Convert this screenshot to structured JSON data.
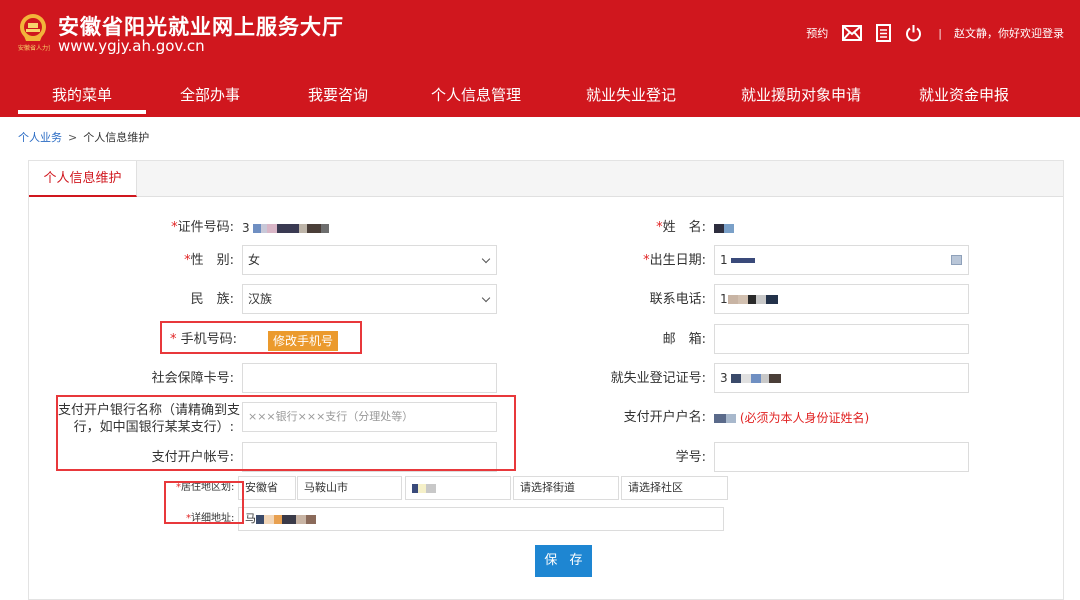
{
  "header": {
    "logo_small_text": "安徽省人力资源",
    "site_title": "安徽省阳光就业网上服务大厅",
    "site_url": "www.ygjy.ah.gov.cn",
    "appointment_label": "预约",
    "divider": "|",
    "welcome_text": "赵文静，你好欢迎登录",
    "icons": [
      "mail-icon",
      "document-icon",
      "power-icon"
    ]
  },
  "nav": {
    "items": [
      {
        "label": "我的菜单"
      },
      {
        "label": "全部办事"
      },
      {
        "label": "我要咨询"
      },
      {
        "label": "个人信息管理"
      },
      {
        "label": "就业失业登记"
      },
      {
        "label": "就业援助对象申请"
      },
      {
        "label": "就业资金申报"
      }
    ]
  },
  "breadcrumb": {
    "root": "个人业务",
    "separator": ">",
    "current": "个人信息维护"
  },
  "tab": {
    "label": "个人信息维护"
  },
  "form": {
    "required_mark": "*",
    "id_number": {
      "label": "证件号码:",
      "value": "3"
    },
    "name": {
      "label": "姓　名:"
    },
    "gender": {
      "label": "性　别:",
      "value": "女"
    },
    "birth_date": {
      "label": "出生日期:",
      "value": "1"
    },
    "ethnicity": {
      "label": "民　族:",
      "value": "汉族"
    },
    "phone": {
      "label": "联系电话:",
      "value": "1"
    },
    "mobile": {
      "label": "手机号码:",
      "button_label": "修改手机号"
    },
    "email": {
      "label": "邮　箱:",
      "value": ""
    },
    "social_card": {
      "label": "社会保障卡号:",
      "value": ""
    },
    "employment_reg": {
      "label": "就失业登记证号:",
      "value": "3"
    },
    "bank_name": {
      "label_line1": "支付开户银行名称（请精确到支",
      "label_line2": "行，如中国银行某某支行）:",
      "placeholder": "×××银行×××支行（分理处等）"
    },
    "account_holder": {
      "label": "支付开户户名:",
      "note": "(必须为本人身份证姓名)"
    },
    "bank_account": {
      "label": "支付开户帐号:",
      "value": ""
    },
    "student_id": {
      "label": "学号:",
      "value": ""
    },
    "residence": {
      "label": "居住地区划:",
      "province": "安徽省",
      "city": "马鞍山市",
      "street_placeholder": "请选择街道",
      "community_placeholder": "请选择社区"
    },
    "address": {
      "label": "详细地址:",
      "value": "马"
    },
    "save_label": "保 存"
  },
  "colors": {
    "brand_red": "#d0171e",
    "required_red": "#e12323",
    "button_orange": "#eb9a2d",
    "save_blue": "#1e86d2",
    "highlight_red": "#e8383b"
  }
}
